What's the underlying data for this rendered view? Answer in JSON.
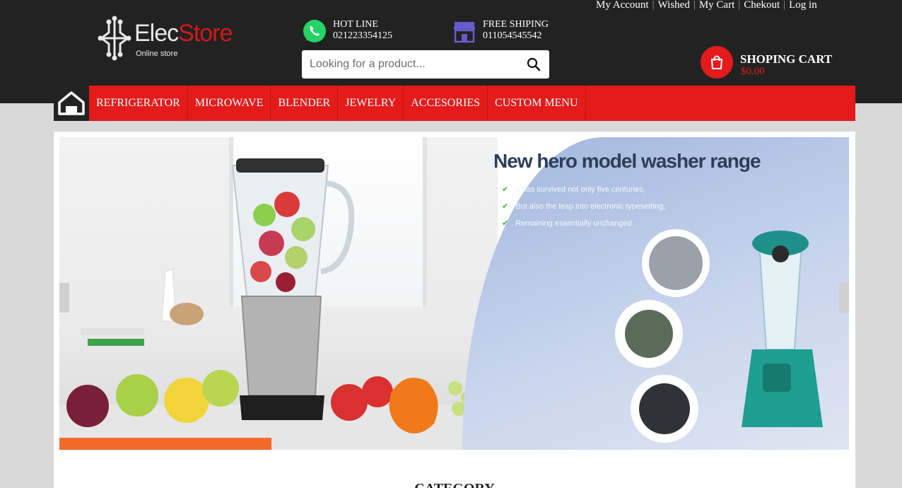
{
  "top_links": [
    "My Account",
    "Wished",
    "My Cart",
    "Chekout",
    "Log in"
  ],
  "logo": {
    "brand_white": "Elec",
    "brand_red": "Store",
    "tagline": "Online store"
  },
  "hotline": {
    "label": "HOT LINE",
    "number": "021223354125"
  },
  "shipping": {
    "label": "FREE SHIPING",
    "number": "011054545542"
  },
  "search": {
    "placeholder": "Looking for a product..."
  },
  "cart": {
    "title": "SHOPING CART",
    "amount": "$0.00"
  },
  "nav": {
    "items": [
      "REFRIGERATOR",
      "MICROWAVE",
      "BLENDER",
      "JEWELRY",
      "ACCESORIES",
      "CUSTOM MENU"
    ]
  },
  "banner": {
    "headline": "New hero model washer range",
    "bullets": [
      "It has survived not only five centuries,",
      "But also the leap into electronic typesetting,",
      "Remaining essentially unchanged"
    ]
  },
  "section": {
    "title": "CATEGORY"
  },
  "colors": {
    "accent": "#e31b1b",
    "dark": "#222222",
    "page_bg": "#d9d9d9"
  }
}
